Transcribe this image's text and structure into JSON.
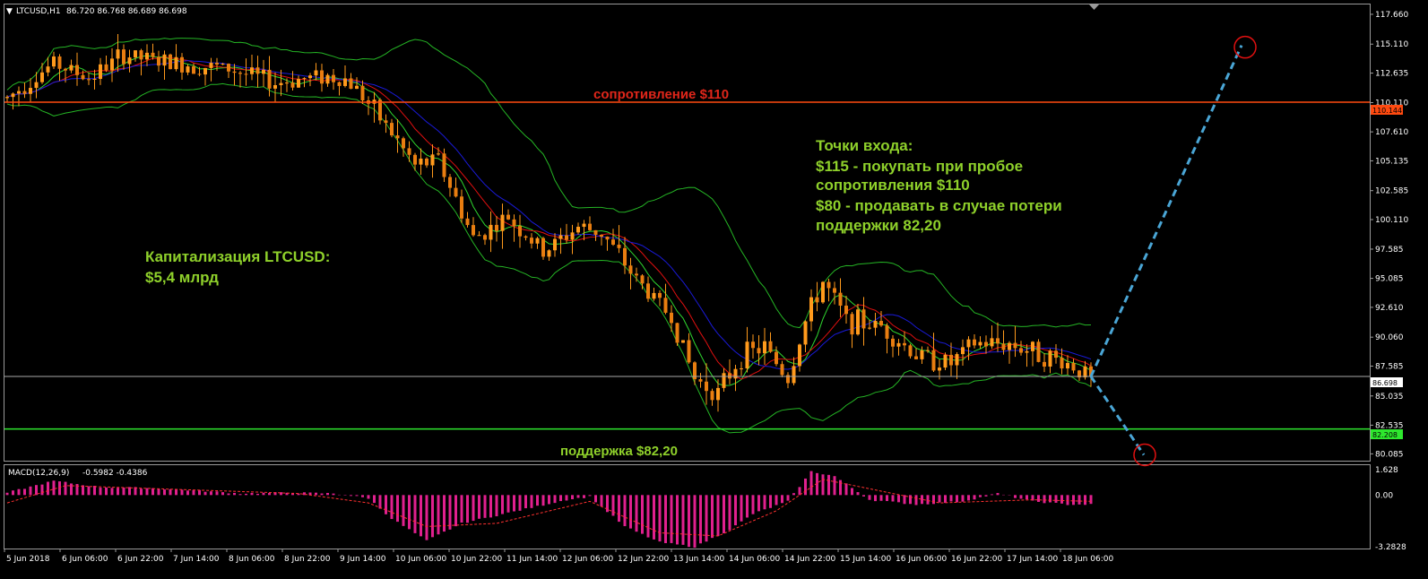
{
  "header": {
    "symbol_label": "LTCUSD,H1",
    "ohlc": "86.720 86.768 86.689 86.698",
    "macd_label": "MACD(12,26,9)",
    "macd_values": "-0.5982 -0.4386"
  },
  "annotations": {
    "resistance": "сопротивление $110",
    "support": "поддержка $82,20",
    "cap_line1": "Капитализация LTCUSD:",
    "cap_line2": "$5,4 млрд",
    "entry_line1": "Точки входа:",
    "entry_line2": "$115 - покупать при пробое",
    "entry_line3": "сопротивления $110",
    "entry_line4": "$80 - продавать в случае потери",
    "entry_line5": "поддержки 82,20"
  },
  "price_tags": {
    "resistance": "110.144",
    "current": "86.698",
    "support": "82.208"
  },
  "colors": {
    "background": "#000000",
    "candle_up": "#ff9a1c",
    "candle_down": "#e87d10",
    "bollinger": "#25b525",
    "ma_fast": "#2fd62f",
    "ma_mid": "#e01010",
    "ma_slow": "#1a1ad8",
    "resistance_line": "#ff4a10",
    "support_line": "#2ee82e",
    "current_line": "#a8a8a8",
    "macd_hist": "#e0208e",
    "macd_signal": "#ff3030",
    "projection": "#4aa6d6",
    "target_circle": "#e01010"
  },
  "chart_data": [
    {
      "type": "candlestick",
      "symbol": "LTCUSD",
      "timeframe": "H1",
      "y_ticks": [
        "117.660",
        "115.110",
        "112.635",
        "110.110",
        "107.610",
        "105.135",
        "102.585",
        "100.110",
        "97.585",
        "95.085",
        "92.610",
        "90.060",
        "87.585",
        "85.035",
        "82.535",
        "80.085"
      ],
      "ylim": [
        79.5,
        118.5
      ],
      "x_ticks": [
        "5 Jun 2018",
        "6 Jun 06:00",
        "6 Jun 22:00",
        "7 Jun 14:00",
        "8 Jun 06:00",
        "8 Jun 22:00",
        "9 Jun 14:00",
        "10 Jun 06:00",
        "10 Jun 22:00",
        "11 Jun 14:00",
        "12 Jun 06:00",
        "12 Jun 22:00",
        "13 Jun 14:00",
        "14 Jun 06:00",
        "14 Jun 22:00",
        "15 Jun 14:00",
        "16 Jun 06:00",
        "16 Jun 22:00",
        "17 Jun 14:00",
        "18 Jun 06:00"
      ],
      "price_path": [
        [
          0,
          110.5
        ],
        [
          8,
          113.5
        ],
        [
          14,
          112.2
        ],
        [
          20,
          114.2
        ],
        [
          26,
          113.6
        ],
        [
          32,
          113.3
        ],
        [
          38,
          113.0
        ],
        [
          46,
          111.8
        ],
        [
          54,
          112.4
        ],
        [
          58,
          112.1
        ],
        [
          60,
          111.3
        ],
        [
          66,
          107.5
        ],
        [
          70,
          104.7
        ],
        [
          74,
          105.2
        ],
        [
          80,
          98.5
        ],
        [
          86,
          100.3
        ],
        [
          92,
          97.3
        ],
        [
          98,
          99.5
        ],
        [
          102,
          99.0
        ],
        [
          108,
          95.0
        ],
        [
          114,
          91.8
        ],
        [
          118,
          86.5
        ],
        [
          122,
          85.3
        ],
        [
          126,
          88.5
        ],
        [
          130,
          89.2
        ],
        [
          134,
          86.5
        ],
        [
          137,
          91.4
        ],
        [
          140,
          94.8
        ],
        [
          144,
          91.5
        ],
        [
          150,
          91.0
        ],
        [
          156,
          88.5
        ],
        [
          162,
          87.8
        ],
        [
          166,
          89.5
        ],
        [
          172,
          89.5
        ],
        [
          178,
          88.5
        ],
        [
          182,
          87.8
        ],
        [
          186,
          86.7
        ]
      ],
      "horizontal_levels": [
        {
          "name": "resistance",
          "value": 110.144
        },
        {
          "name": "current",
          "value": 86.698
        },
        {
          "name": "support",
          "value": 82.208
        }
      ],
      "projection": {
        "from": 86.698,
        "up_target": 115,
        "down_target": 80
      }
    },
    {
      "type": "histogram",
      "name": "MACD(12,26,9)",
      "y_ticks": [
        "1.628",
        "0.00",
        "-3.2828"
      ],
      "ylim": [
        -3.4,
        1.9
      ],
      "values_path": [
        [
          0,
          0.15
        ],
        [
          8,
          0.9
        ],
        [
          16,
          0.5
        ],
        [
          24,
          0.45
        ],
        [
          32,
          0.3
        ],
        [
          40,
          0.1
        ],
        [
          48,
          0.15
        ],
        [
          56,
          0.1
        ],
        [
          62,
          -0.2
        ],
        [
          66,
          -1.5
        ],
        [
          72,
          -2.9
        ],
        [
          78,
          -1.8
        ],
        [
          84,
          -1.3
        ],
        [
          90,
          -0.8
        ],
        [
          96,
          -0.3
        ],
        [
          100,
          -0.1
        ],
        [
          106,
          -2.0
        ],
        [
          112,
          -3.0
        ],
        [
          118,
          -3.3
        ],
        [
          124,
          -2.2
        ],
        [
          128,
          -1.2
        ],
        [
          134,
          -0.4
        ],
        [
          138,
          1.5
        ],
        [
          142,
          1.2
        ],
        [
          148,
          -0.3
        ],
        [
          156,
          -0.6
        ],
        [
          164,
          -0.4
        ],
        [
          170,
          0.1
        ],
        [
          176,
          -0.4
        ],
        [
          182,
          -0.6
        ],
        [
          186,
          -0.6
        ]
      ],
      "signal_path": [
        [
          0,
          -0.5
        ],
        [
          10,
          0.6
        ],
        [
          30,
          0.35
        ],
        [
          50,
          0.1
        ],
        [
          62,
          -0.5
        ],
        [
          72,
          -2.0
        ],
        [
          84,
          -1.8
        ],
        [
          100,
          -0.4
        ],
        [
          112,
          -2.4
        ],
        [
          122,
          -2.6
        ],
        [
          132,
          -1.0
        ],
        [
          140,
          1.0
        ],
        [
          148,
          0.4
        ],
        [
          160,
          -0.5
        ],
        [
          176,
          -0.3
        ],
        [
          186,
          -0.4
        ]
      ]
    }
  ]
}
